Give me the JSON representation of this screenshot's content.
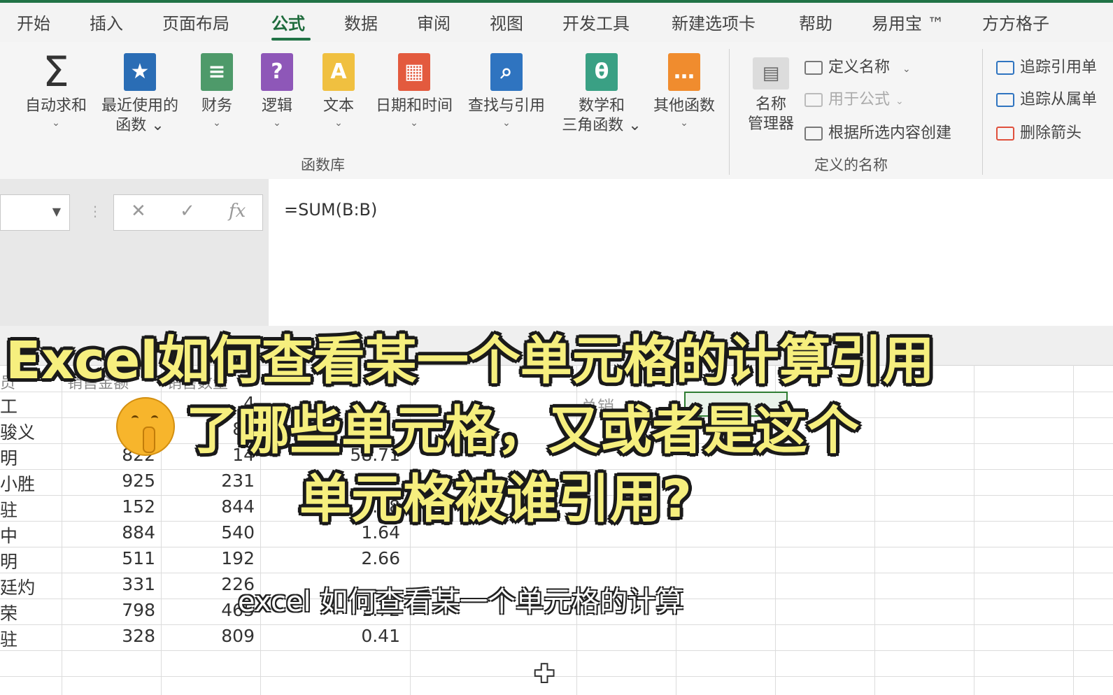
{
  "ribbon_tabs": [
    "开始",
    "插入",
    "页面布局",
    "公式",
    "数据",
    "审阅",
    "视图",
    "开发工具",
    "新建选项卡",
    "帮助",
    "易用宝 ™",
    "方方格子"
  ],
  "active_tab": "公式",
  "function_library": {
    "group_label": "函数库",
    "buttons": [
      {
        "line1": "自动求和",
        "line2": "",
        "icon": "sigma-icon",
        "color": "#333333"
      },
      {
        "line1": "最近使用的",
        "line2": "函数 ⌄",
        "icon": "star-book-icon",
        "color": "#2a6db5"
      },
      {
        "line1": "财务",
        "line2": "",
        "icon": "finance-book-icon",
        "color": "#4e9a6a"
      },
      {
        "line1": "逻辑",
        "line2": "",
        "icon": "question-book-icon",
        "color": "#8e57b8"
      },
      {
        "line1": "文本",
        "line2": "",
        "icon": "text-book-icon",
        "color": "#f0c040"
      },
      {
        "line1": "日期和时间",
        "line2": "",
        "icon": "calendar-book-icon",
        "color": "#e35a3e"
      },
      {
        "line1": "查找与引用",
        "line2": "",
        "icon": "search-book-icon",
        "color": "#2f74c0"
      },
      {
        "line1": "数学和",
        "line2": "三角函数 ⌄",
        "icon": "theta-book-icon",
        "color": "#3aa084"
      },
      {
        "line1": "其他函数",
        "line2": "",
        "icon": "more-book-icon",
        "color": "#f08c2e"
      }
    ]
  },
  "defined_names": {
    "group_label": "定义的名称",
    "manager_line1": "名称",
    "manager_line2": "管理器",
    "define_name": "定义名称",
    "use_in_formula": "用于公式",
    "create_from_selection": "根据所选内容创建"
  },
  "formula_auditing": {
    "trace_precedents": "追踪引用单",
    "trace_dependents": "追踪从属单",
    "remove_arrows": "删除箭头"
  },
  "formula_bar": {
    "cancel": "✕",
    "enter": "✓",
    "fx": "fx",
    "formula": "=SUM(B:B)"
  },
  "sheet": {
    "headers": [
      "员",
      "销售金额",
      "销售数量",
      "",
      "",
      "总销"
    ],
    "rows": [
      {
        "a": "工",
        "b": "",
        "c": "4",
        "d": "5"
      },
      {
        "a": "骏义",
        "b": "",
        "c": "84",
        "d": ""
      },
      {
        "a": "明",
        "b": "822",
        "c": "14",
        "d": "58.71"
      },
      {
        "a": "小胜",
        "b": "925",
        "c": "231",
        "d": ""
      },
      {
        "a": "驻",
        "b": "152",
        "c": "844",
        "d": "0.18"
      },
      {
        "a": "中",
        "b": "884",
        "c": "540",
        "d": "1.64"
      },
      {
        "a": "明",
        "b": "511",
        "c": "192",
        "d": "2.66"
      },
      {
        "a": "廷灼",
        "b": "331",
        "c": "226",
        "d": ""
      },
      {
        "a": "荣",
        "b": "798",
        "c": "465",
        "d": "1.72"
      },
      {
        "a": "驻",
        "b": "328",
        "c": "809",
        "d": "0.41"
      }
    ]
  },
  "overlay": {
    "title_line1": "Excel如何查看某一个单元格的计算引用",
    "title_line2": "了哪些单元格，又或者是这个",
    "title_line3": "单元格被谁引用?",
    "subtitle": "excel 如何查看某一个单元格的计算",
    "emoji": "shushing-face-icon"
  }
}
